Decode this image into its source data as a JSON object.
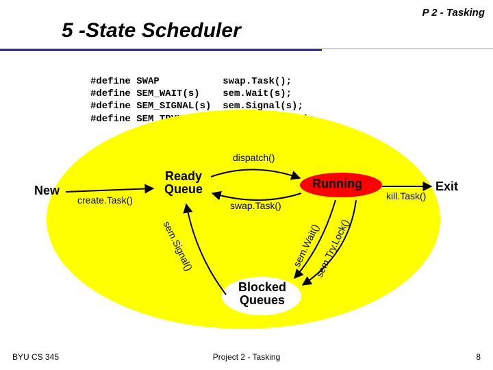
{
  "header_tag": "P 2 - Tasking",
  "title": "5 -State Scheduler",
  "code": "#define SWAP           swap.Task();\n#define SEM_WAIT(s)    sem.Wait(s);\n#define SEM_SIGNAL(s)  sem.Signal(s);\n#define SEM_TRYLOCK(s) sem.Try.Lock(s);",
  "states": {
    "new": "New",
    "ready": "Ready Queue",
    "running": "Running",
    "blocked": "Blocked Queues",
    "exit": "Exit"
  },
  "edges": {
    "create": "create.Task()",
    "dispatch": "dispatch()",
    "swap": "swap.Task()",
    "kill": "kill.Task()",
    "signal": "sem.Signal()",
    "wait": "sem.Wait()",
    "trylock": "sem.Try.Lock()"
  },
  "footer": {
    "left": "BYU CS 345",
    "center": "Project 2 - Tasking",
    "right": "8"
  }
}
